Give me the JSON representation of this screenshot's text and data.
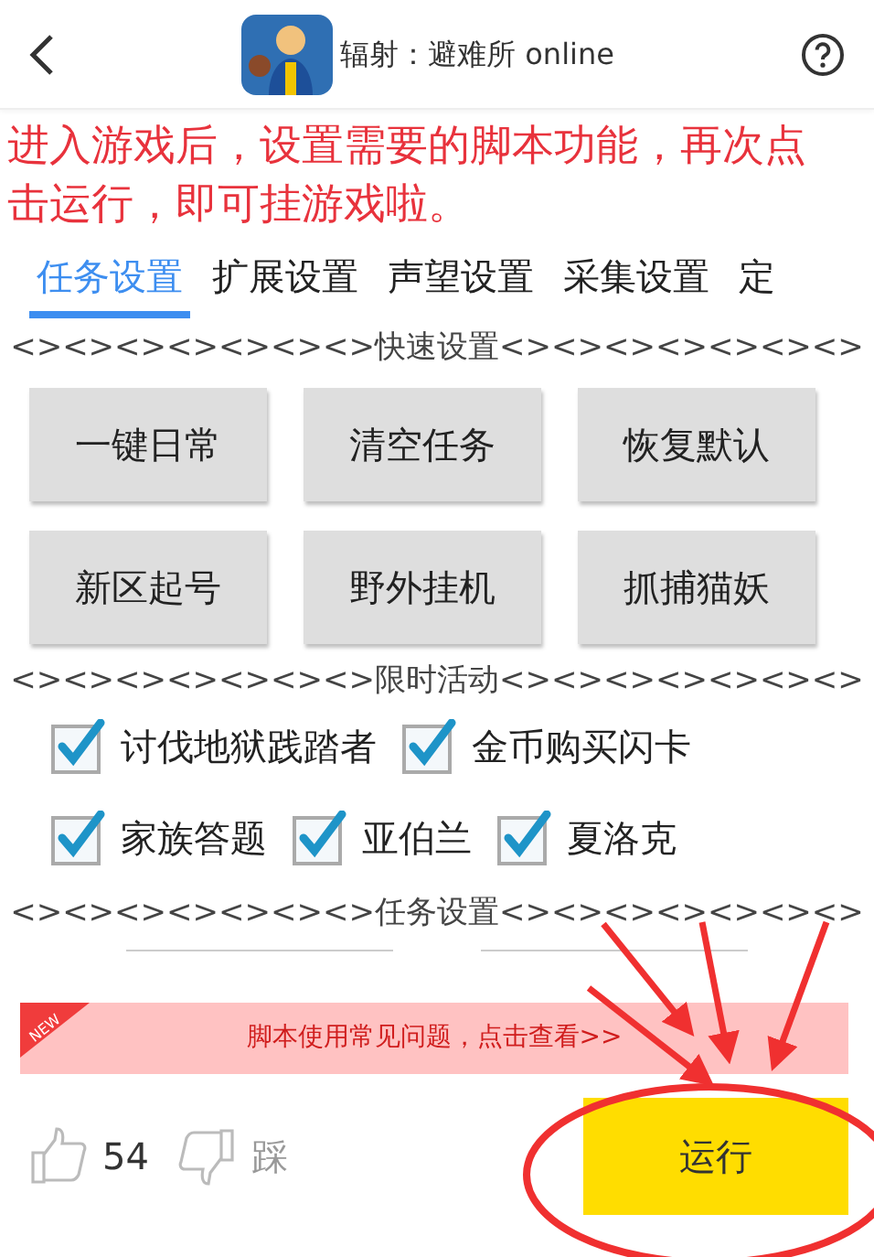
{
  "header": {
    "title": "辐射：避难所 online"
  },
  "notice": "进入游戏后，设置需要的脚本功能，再次点击运行，即可挂游戏啦。",
  "tabs": [
    {
      "label": "任务设置",
      "selected": true
    },
    {
      "label": "扩展设置",
      "selected": false
    },
    {
      "label": "声望设置",
      "selected": false
    },
    {
      "label": "采集设置",
      "selected": false
    },
    {
      "label": "定",
      "selected": false
    }
  ],
  "quick_settings": {
    "title": "<><><><><><><>快速设置<><><><><><><>",
    "buttons": [
      "一键日常",
      "清空任务",
      "恢复默认",
      "新区起号",
      "野外挂机",
      "抓捕猫妖"
    ]
  },
  "limited_events": {
    "title": "<><><><><><><>限时活动<><><><><><><>",
    "options": [
      {
        "label": "讨伐地狱践踏者",
        "checked": true
      },
      {
        "label": "金币购买闪卡",
        "checked": true
      },
      {
        "label": "家族答题",
        "checked": true
      },
      {
        "label": "亚伯兰",
        "checked": true
      },
      {
        "label": "夏洛克",
        "checked": true
      }
    ]
  },
  "task_settings": {
    "title": "<><><><><><><>任务设置<><><><><><><>"
  },
  "banner": {
    "badge": "NEW",
    "text": "脚本使用常见问题，点击查看>>"
  },
  "footer": {
    "likes": "54",
    "dislike_label": "踩",
    "run_button": "运行"
  }
}
